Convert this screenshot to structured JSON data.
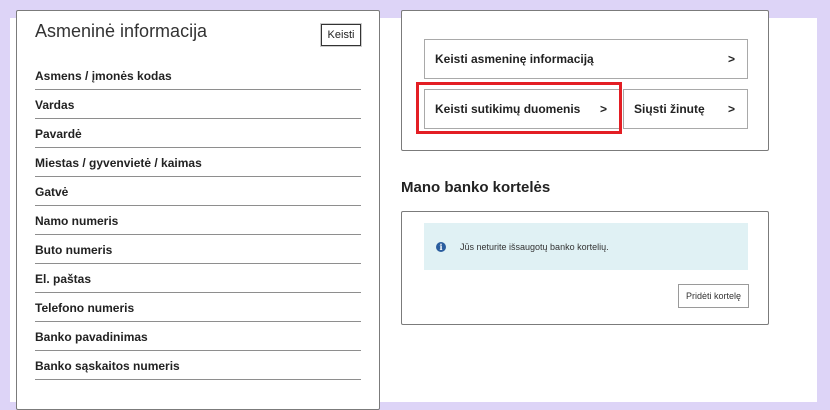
{
  "personal": {
    "title": "Asmeninė informacija",
    "edit_label": "Keisti",
    "fields": [
      "Asmens / įmonės kodas",
      "Vardas",
      "Pavardė",
      "Miestas / gyvenvietė / kaimas",
      "Gatvė",
      "Namo numeris",
      "Buto numeris",
      "El. paštas",
      "Telefono numeris",
      "Banko pavadinimas",
      "Banko sąskaitos numeris"
    ]
  },
  "actions": {
    "edit_personal": "Keisti asmeninę informaciją",
    "edit_consents": "Keisti sutikimų duomenis",
    "send_message": "Siųsti žinutę",
    "chevron": ">"
  },
  "cards": {
    "heading": "Mano banko kortelės",
    "info_text": "Jūs neturite išsaugotų banko kortelių.",
    "info_icon_glyph": "i",
    "add_card_label": "Pridėti kortelę"
  },
  "colors": {
    "background_frame": "#ddd4f7",
    "highlight": "#e31e24",
    "info_box": "#e0f1f4",
    "info_icon": "#2a5d9e"
  }
}
